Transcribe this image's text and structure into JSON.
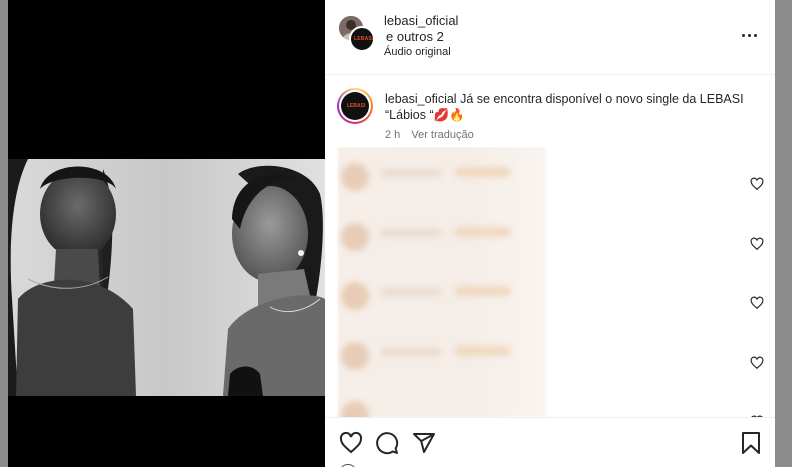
{
  "post": {
    "header": {
      "username": "lebasi_oficial",
      "collaborators": "e outros 2",
      "audio": "Áudio original",
      "menu_icon": "more-horizontal-icon"
    },
    "caption": {
      "username": "lebasi_oficial",
      "text": "Já se encontra disponível o novo single da LEBASI “Lábios “",
      "emojis": "💋🔥",
      "time": "2 h",
      "translate_label": "Ver tradução"
    },
    "comments": {
      "like_icon": "heart-outline-icon"
    },
    "actions": {
      "like_icon": "heart-outline-icon",
      "comment_icon": "comment-bubble-icon",
      "share_icon": "send-plane-icon",
      "save_icon": "bookmark-outline-icon"
    },
    "logo_text": "LEBASI"
  }
}
